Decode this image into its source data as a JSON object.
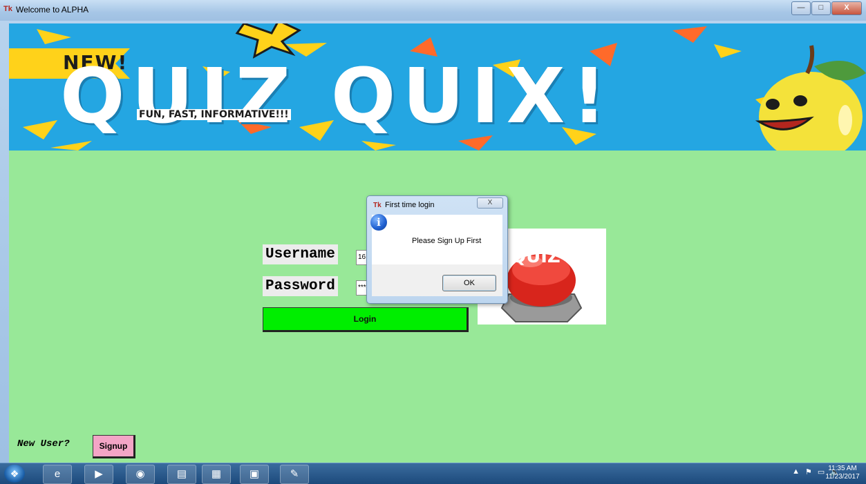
{
  "window": {
    "title": "Welcome to ALPHA",
    "app_icon": "Tk",
    "controls": {
      "minimize": "—",
      "maximize": "□",
      "close": "X"
    }
  },
  "banner": {
    "ribbon_text": "NEW!",
    "title": "QUIZ QUIX!",
    "subtitle": "FUN, FAST, INFORMATIVE!!!"
  },
  "login": {
    "username_label": "Username",
    "username_value": "16",
    "password_label": "Password",
    "password_value": "***",
    "login_button": "Login",
    "image_caption": "QUIZ"
  },
  "signup": {
    "prompt": "New User?",
    "button": "Signup"
  },
  "dialog": {
    "icon": "Tk",
    "title": "First time login",
    "close": "X",
    "message": "Please Sign Up First",
    "ok_button": "OK",
    "info_glyph": "i"
  },
  "taskbar": {
    "start_glyph": "❖",
    "items": [
      "e",
      "▶",
      "◉",
      "▤",
      "▦",
      "▣",
      "✎"
    ],
    "tray": [
      "▲",
      "⚑",
      "▭",
      "🔈"
    ],
    "time": "11:35 AM",
    "date": "11/23/2017"
  },
  "colors": {
    "client_bg": "#98e898",
    "login_button": "#00ee00",
    "signup_button": "#f3a5c6",
    "banner_bg": "#24a6e2"
  }
}
